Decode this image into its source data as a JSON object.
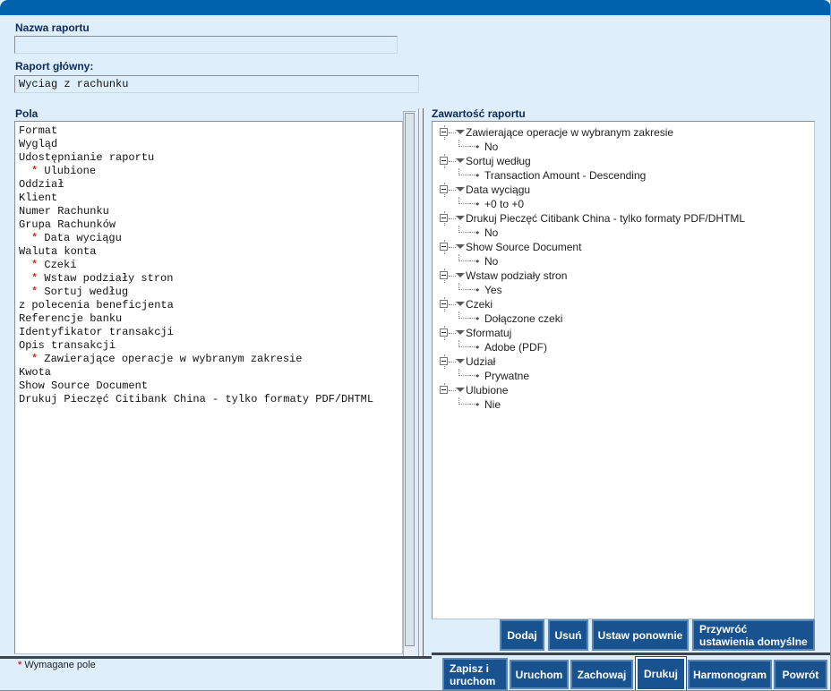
{
  "window": {
    "title_bar_color": "#0061ac",
    "page_background": "#dfeefb"
  },
  "form": {
    "report_name_label": "Nazwa raportu",
    "report_name_value": "",
    "report_name_placeholder": "",
    "main_report_label": "Raport główny:",
    "main_report_value": "Wyciag z rachunku"
  },
  "fields_panel": {
    "label": "Pola",
    "items": [
      {
        "text": "Format",
        "required": false
      },
      {
        "text": "Wygląd",
        "required": false
      },
      {
        "text": "Udostępnianie raportu",
        "required": false
      },
      {
        "text": "Ulubione",
        "required": true
      },
      {
        "text": "Oddział",
        "required": false
      },
      {
        "text": "Klient",
        "required": false
      },
      {
        "text": "Numer Rachunku",
        "required": false
      },
      {
        "text": "Grupa Rachunków",
        "required": false
      },
      {
        "text": "Data wyciągu",
        "required": true
      },
      {
        "text": "Waluta konta",
        "required": false
      },
      {
        "text": "Czeki",
        "required": true
      },
      {
        "text": "Wstaw podziały stron",
        "required": true
      },
      {
        "text": "Sortuj według",
        "required": true
      },
      {
        "text": "z polecenia beneficjenta",
        "required": false
      },
      {
        "text": "Referencje banku",
        "required": false
      },
      {
        "text": "Identyfikator transakcji",
        "required": false
      },
      {
        "text": "Opis transakcji",
        "required": false
      },
      {
        "text": "Zawierające operacje w wybranym zakresie",
        "required": true
      },
      {
        "text": "Kwota",
        "required": false
      },
      {
        "text": "Show Source Document",
        "required": false
      },
      {
        "text": "Drukuj Pieczęć Citibank China - tylko formaty PDF/DHTML",
        "required": false
      }
    ]
  },
  "content_panel": {
    "label": "Zawartość raportu",
    "nodes": [
      {
        "label": "Zawierające operacje w wybranym zakresie",
        "value": "No"
      },
      {
        "label": "Sortuj według",
        "value": "Transaction Amount - Descending"
      },
      {
        "label": "Data wyciągu",
        "value": "+0 to +0"
      },
      {
        "label": "Drukuj Pieczęć Citibank China - tylko formaty PDF/DHTML",
        "value": "No"
      },
      {
        "label": "Show Source Document",
        "value": "No"
      },
      {
        "label": "Wstaw podziały stron",
        "value": "Yes"
      },
      {
        "label": "Czeki",
        "value": "Dołączone czeki"
      },
      {
        "label": "Sformatuj",
        "value": "Adobe (PDF)"
      },
      {
        "label": "Udział",
        "value": "Prywatne"
      },
      {
        "label": "Ulubione",
        "value": "Nie"
      }
    ],
    "bullet_glyph": "•",
    "expander_state": "expanded"
  },
  "content_buttons": [
    {
      "name": "add",
      "label": "Dodaj"
    },
    {
      "name": "remove",
      "label": "Usuń"
    },
    {
      "name": "reset",
      "label": "Ustaw ponownie"
    },
    {
      "name": "restore-defaults",
      "label_line1": "Przywróć",
      "label_line2": "ustawienia domyślne"
    }
  ],
  "footer": {
    "required_note_star": "*",
    "required_note_text": "Wymagane pole",
    "buttons": [
      {
        "name": "save-and-run",
        "label_line1": "Zapisz i",
        "label_line2": "uruchom",
        "focused": false
      },
      {
        "name": "run",
        "label": "Uruchom",
        "focused": false
      },
      {
        "name": "save",
        "label": "Zachowaj",
        "focused": false
      },
      {
        "name": "print",
        "label": "Drukuj",
        "focused": true
      },
      {
        "name": "schedule",
        "label": "Harmonogram",
        "focused": false
      },
      {
        "name": "back",
        "label": "Powrót",
        "focused": false
      }
    ]
  },
  "colors": {
    "button_fill": "#18538f",
    "button_border": "#5b86b5",
    "required_star": "#c0392b",
    "label_text": "#0d2a5c",
    "banner": "#0061ac"
  }
}
